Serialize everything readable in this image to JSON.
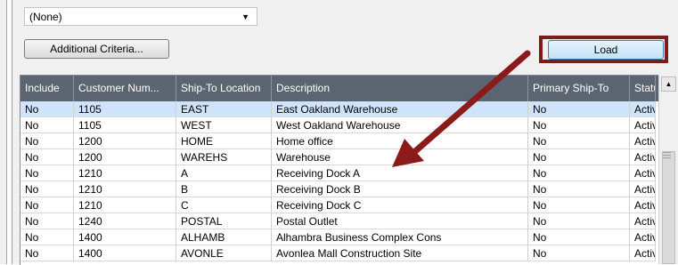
{
  "filter": {
    "selected": "(None)"
  },
  "buttons": {
    "additional_criteria": "Additional Criteria...",
    "load": "Load"
  },
  "icons": {
    "dropdown": "chevron-down-icon",
    "scroll_up": "arrow-up-icon",
    "grip": "grip-icon"
  },
  "colors": {
    "header_bg": "#5b6572",
    "selected_row": "#cfe3fb",
    "highlight_border": "#7a1c1c",
    "arrow": "#8b1a1a"
  },
  "grid": {
    "columns": [
      "Include",
      "Customer Num...",
      "Ship-To Location",
      "Description",
      "Primary Ship-To",
      "Statu"
    ],
    "rows": [
      [
        "No",
        "1105",
        "EAST",
        "East Oakland Warehouse",
        "No",
        "Activ"
      ],
      [
        "No",
        "1105",
        "WEST",
        "West Oakland Warehouse",
        "No",
        "Activ"
      ],
      [
        "No",
        "1200",
        "HOME",
        "Home office",
        "No",
        "Activ"
      ],
      [
        "No",
        "1200",
        "WAREHS",
        "Warehouse",
        "No",
        "Activ"
      ],
      [
        "No",
        "1210",
        "A",
        "Receiving Dock A",
        "No",
        "Activ"
      ],
      [
        "No",
        "1210",
        "B",
        "Receiving Dock B",
        "No",
        "Activ"
      ],
      [
        "No",
        "1210",
        "C",
        "Receiving Dock C",
        "No",
        "Activ"
      ],
      [
        "No",
        "1240",
        "POSTAL",
        "Postal Outlet",
        "No",
        "Activ"
      ],
      [
        "No",
        "1400",
        "ALHAMB",
        "Alhambra Business Complex Cons",
        "No",
        "Activ"
      ],
      [
        "No",
        "1400",
        "AVONLE",
        "Avonlea Mall Construction Site",
        "No",
        "Activ"
      ]
    ]
  }
}
